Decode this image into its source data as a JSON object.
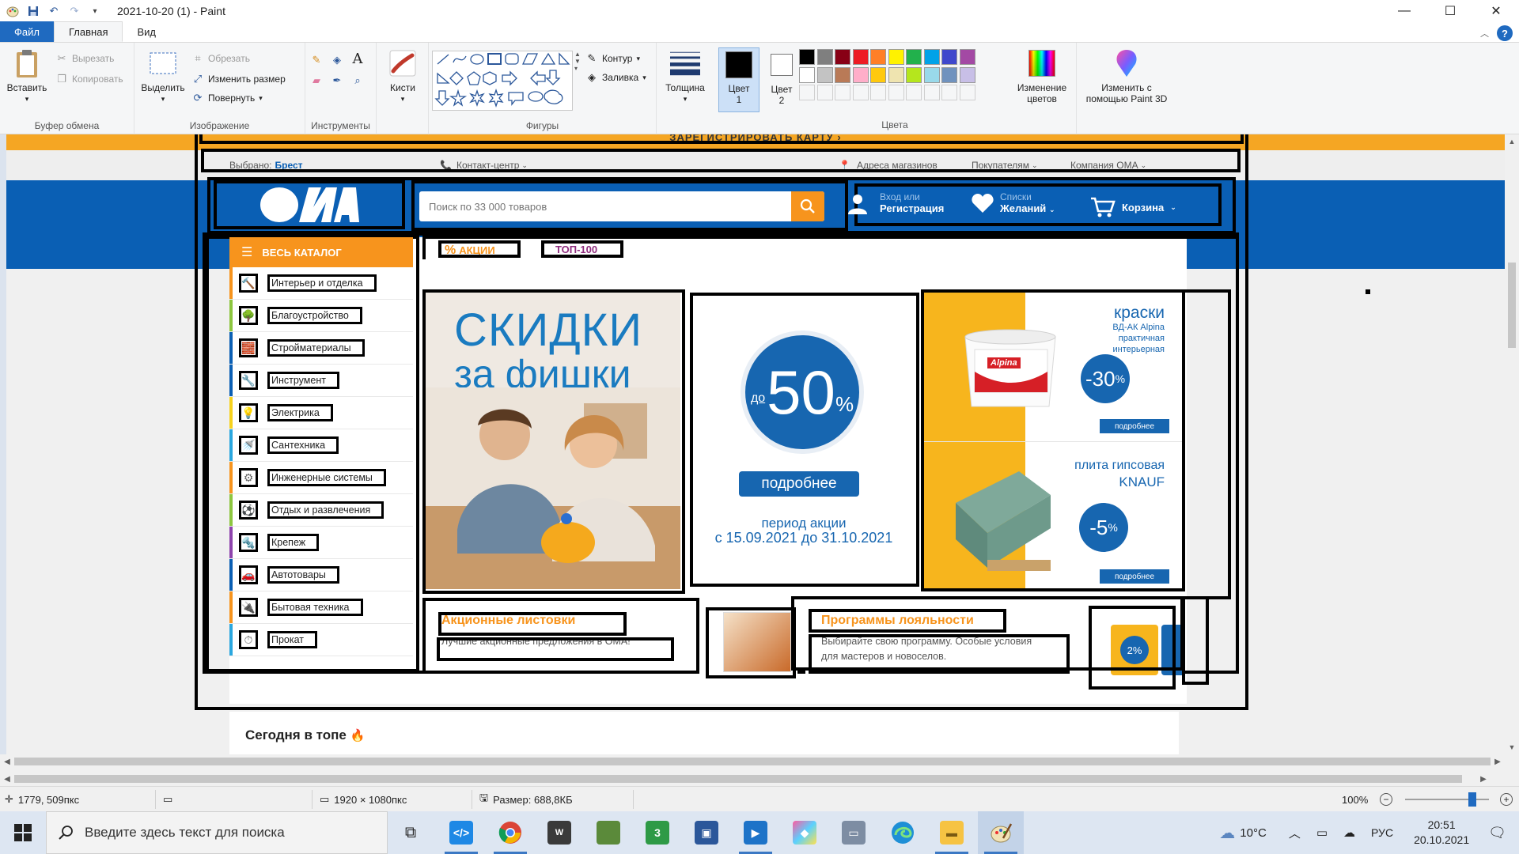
{
  "window": {
    "title": "2021-10-20 (1) - Paint",
    "controls": {
      "minimize": "—",
      "maximize": "☐",
      "close": "✕"
    }
  },
  "ribbon_tabs": {
    "file": "Файл",
    "home": "Главная",
    "view": "Вид"
  },
  "ribbon": {
    "clipboard": {
      "paste": "Вставить",
      "cut": "Вырезать",
      "copy": "Копировать",
      "label": "Буфер обмена"
    },
    "image": {
      "select": "Выделить",
      "crop": "Обрезать",
      "resize": "Изменить размер",
      "rotate": "Повернуть",
      "label": "Изображение"
    },
    "tools": {
      "label": "Инструменты"
    },
    "brushes": {
      "label": "Кисти"
    },
    "shapes": {
      "outline": "Контур",
      "fill": "Заливка",
      "label": "Фигуры"
    },
    "size": {
      "label": "Толщина"
    },
    "color1": {
      "label": "Цвет",
      "num": "1"
    },
    "color2": {
      "label": "Цвет",
      "num": "2"
    },
    "colors": {
      "label": "Цвета",
      "edit_label": "Изменение",
      "edit_label2": "цветов",
      "palette_row1": [
        "#000000",
        "#7f7f7f",
        "#880015",
        "#ed1c24",
        "#ff7f27",
        "#fff200",
        "#22b14c",
        "#00a2e8",
        "#3f48cc",
        "#a349a4"
      ],
      "palette_row2": [
        "#ffffff",
        "#c3c3c3",
        "#b97a57",
        "#ffaec9",
        "#ffc90e",
        "#efe4b0",
        "#b5e61d",
        "#99d9ea",
        "#7092be",
        "#c8bfe7"
      ]
    },
    "paint3d": {
      "label1": "Изменить с",
      "label2": "помощью Paint 3D"
    }
  },
  "site": {
    "promo_strip": "ЗАРЕГИСТРИРОВАТЬ КАРТУ  ›",
    "info": {
      "chosen_label": "Выбрано:",
      "chosen_city": "Брест",
      "contact_center": "Контакт-центр",
      "store_addresses": "Адреса магазинов",
      "buyers": "Покупателям",
      "company": "Компания ОМА"
    },
    "header": {
      "logo_text": "OMA",
      "search_placeholder": "Поиск по 33 000 товаров",
      "login_sub": "Вход или",
      "login_main": "Регистрация",
      "wishlist_sub": "Списки",
      "wishlist_main": "Желаний",
      "cart": "Корзина"
    },
    "catalog": {
      "title": "ВЕСЬ КАТАЛОГ",
      "items": [
        {
          "label": "Интерьер и отделка",
          "icon": "🔨",
          "color": "#f7941d"
        },
        {
          "label": "Благоустройство",
          "icon": "🌳",
          "color": "#8dc63f"
        },
        {
          "label": "Стройматериалы",
          "icon": "🧱",
          "color": "#0a5fb4"
        },
        {
          "label": "Инструмент",
          "icon": "🔧",
          "color": "#0a5fb4"
        },
        {
          "label": "Электрика",
          "icon": "💡",
          "color": "#f7d21d"
        },
        {
          "label": "Сантехника",
          "icon": "🚿",
          "color": "#2aa7df"
        },
        {
          "label": "Инженерные системы",
          "icon": "⚙",
          "color": "#f7941d"
        },
        {
          "label": "Отдых и развлечения",
          "icon": "⚽",
          "color": "#8dc63f"
        },
        {
          "label": "Крепеж",
          "icon": "🔩",
          "color": "#8e44ad"
        },
        {
          "label": "Автотовары",
          "icon": "🚗",
          "color": "#0a5fb4"
        },
        {
          "label": "Бытовая техника",
          "icon": "🔌",
          "color": "#f7941d"
        },
        {
          "label": "Прокат",
          "icon": "⏱",
          "color": "#2aa7df"
        }
      ]
    },
    "tabs": {
      "sales_icon": "%",
      "sales": "АКЦИИ",
      "top100": "ТОП-100"
    },
    "banner1": {
      "line1": "СКИДКИ",
      "line2": "за фишки"
    },
    "banner2": {
      "prefix": "до",
      "value": "50",
      "pct": "%",
      "button": "подробнее",
      "period1": "период акции",
      "period2": "с 15.09.2021 до 31.10.2021"
    },
    "banner3": {
      "title1": "краски",
      "sub1": "ВД-АК Alpina",
      "sub2": "практичная",
      "sub3": "интерьерная",
      "discount1": "-30",
      "pct": "%",
      "button": "подробнее",
      "title2a": "плита гипсовая",
      "title2b": "KNAUF",
      "discount2": "-5",
      "brand": "Alpina"
    },
    "card1": {
      "title": "Акционные листовки",
      "text": "Лучшие акционные предложения в ОМА!"
    },
    "card2": {
      "title": "Программы лояльности",
      "text1": "Выбирайте свою программу. Особые условия",
      "text2": "для мастеров и новоселов.",
      "badge": "2%"
    },
    "today": {
      "title": "Сегодня в топе",
      "emoji": "🔥"
    }
  },
  "statusbar": {
    "cursor": "1779, 509пкс",
    "dimensions": "1920 × 1080пкс",
    "size": "Размер: 688,8КБ",
    "zoom": "100%",
    "zoom_percent": 100
  },
  "taskbar": {
    "search_placeholder": "Введите здесь текст для поиска",
    "weather": "10°C",
    "lang": "РУС",
    "time": "20:51",
    "date": "20.10.2021"
  }
}
